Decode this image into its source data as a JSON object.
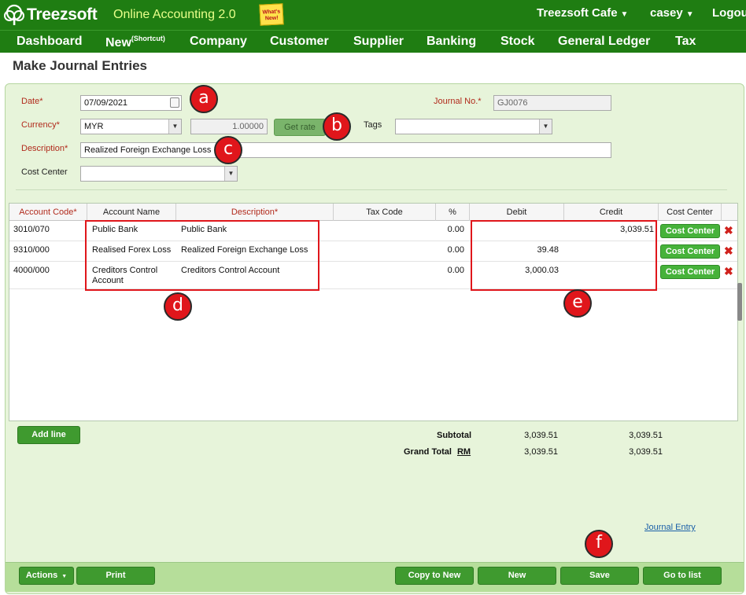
{
  "header": {
    "logo_text": "Treezsoft",
    "product": "Online Accounting 2.0",
    "whats_new": "What's New!",
    "company": "Treezsoft Cafe",
    "user": "casey",
    "logout": "Logout",
    "dropdown_caret": "▼"
  },
  "nav": {
    "items": [
      "Dashboard",
      "New",
      "Company",
      "Customer",
      "Supplier",
      "Banking",
      "Stock",
      "General Ledger",
      "Tax"
    ],
    "new_suffix": "(Shortcut)"
  },
  "page": {
    "title": "Make Journal Entries"
  },
  "form": {
    "date_label": "Date*",
    "date_value": "07/09/2021",
    "currency_label": "Currency*",
    "currency_value": "MYR",
    "rate_value": "1.00000",
    "get_rate_label": "Get rate",
    "tags_label": "Tags",
    "tags_value": "",
    "journal_no_label": "Journal No.*",
    "journal_no_value": "GJ0076",
    "description_label": "Description*",
    "description_value": "Realized Foreign Exchange Loss",
    "cost_center_label": "Cost Center",
    "cost_center_value": ""
  },
  "table": {
    "columns": [
      "Account Code*",
      "Account Name",
      "Description*",
      "Tax Code",
      "%",
      "Debit",
      "Credit",
      "Cost Center"
    ],
    "rows": [
      {
        "code": "3010/070",
        "name": "Public Bank",
        "description": "Public Bank",
        "tax_code": "",
        "pct": "0.00",
        "debit": "",
        "credit": "3,039.51",
        "cost_center": "Cost Center"
      },
      {
        "code": "9310/000",
        "name": "Realised Forex Loss",
        "description": "Realized Foreign Exchange Loss",
        "tax_code": "",
        "pct": "0.00",
        "debit": "39.48",
        "credit": "",
        "cost_center": "Cost Center"
      },
      {
        "code": "4000/000",
        "name_line1": "Creditors Control",
        "name_line2": "Account",
        "description": "Creditors Control Account",
        "tax_code": "",
        "pct": "0.00",
        "debit": "3,000.03",
        "credit": "",
        "cost_center": "Cost Center"
      }
    ],
    "delete_glyph": "✖"
  },
  "totals": {
    "add_line": "Add line",
    "subtotal_label": "Subtotal",
    "subtotal_debit": "3,039.51",
    "subtotal_credit": "3,039.51",
    "grand_total_label": "Grand Total",
    "currency_code": "RM",
    "grand_debit": "3,039.51",
    "grand_credit": "3,039.51"
  },
  "journal_entry_link": "Journal Entry",
  "footer": {
    "actions": "Actions",
    "print": "Print",
    "copy_to_new": "Copy to New",
    "new": "New",
    "save": "Save",
    "go_to_list": "Go to list"
  },
  "annotations": {
    "a": "a",
    "b": "b",
    "c": "c",
    "d": "d",
    "e": "e",
    "f": "f"
  },
  "colors": {
    "brand_green": "#1f7d12",
    "panel_bg": "#e7f4da",
    "button_green": "#3f9a2f",
    "cost_center_green": "#46b23a",
    "marker_red": "#e0161b",
    "required_label": "#b12a1c"
  }
}
